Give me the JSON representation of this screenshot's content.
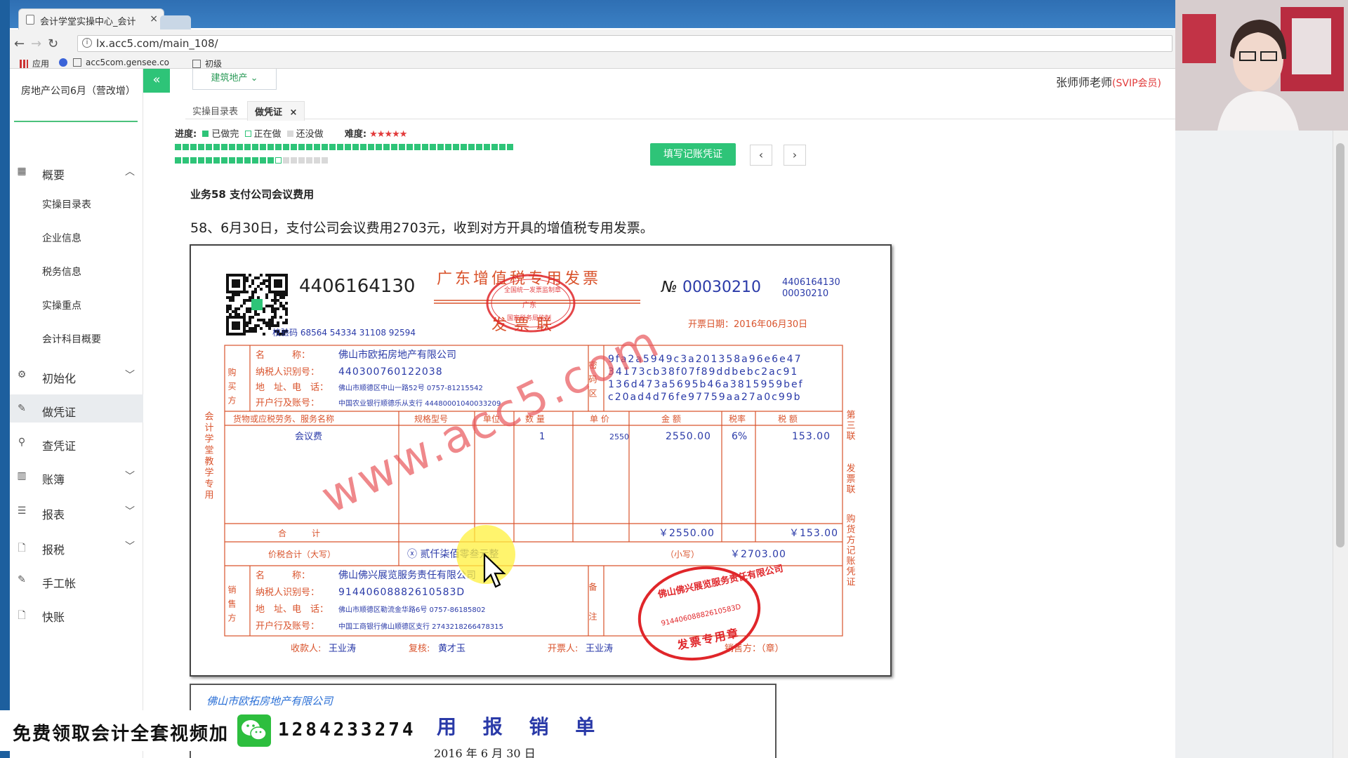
{
  "browser": {
    "tab_title": "会计学堂实操中心_会计",
    "tab_close": "×",
    "url": "lx.acc5.com/main_108/",
    "bookmarks": [
      "应用",
      "acc5com.gensee.co",
      "初级"
    ]
  },
  "header": {
    "collapse_icon": "«",
    "industry_select": "建筑地产",
    "teacher_name": "张师师老师",
    "teacher_badge": "(SVIP会员)"
  },
  "sidebar": {
    "company": "房地产公司6月（营改增）",
    "items": [
      {
        "label": "概要",
        "icon": "grid-icon",
        "expanded": true
      },
      {
        "label": "实操目录表"
      },
      {
        "label": "企业信息"
      },
      {
        "label": "税务信息"
      },
      {
        "label": "实操重点"
      },
      {
        "label": "会计科目概要"
      },
      {
        "label": "初始化",
        "icon": "gear-icon"
      },
      {
        "label": "做凭证",
        "icon": "pen-icon",
        "active": true
      },
      {
        "label": "查凭证",
        "icon": "search-icon"
      },
      {
        "label": "账簿",
        "icon": "book-icon"
      },
      {
        "label": "报表",
        "icon": "list-icon"
      },
      {
        "label": "报税",
        "icon": "file-icon"
      },
      {
        "label": "手工帐",
        "icon": "pen-icon"
      },
      {
        "label": "快账",
        "icon": "file-icon"
      }
    ]
  },
  "tabs": [
    {
      "label": "实操目录表",
      "active": false
    },
    {
      "label": "做凭证",
      "active": true,
      "close": "×"
    }
  ],
  "progress": {
    "label": "进度:",
    "legend_done": "已做完",
    "legend_doing": "正在做",
    "legend_todo": "还没做",
    "difficulty_label": "难度:",
    "difficulty_stars": "★★★★★",
    "done_count": 57,
    "doing_index": 58,
    "total": 64,
    "colors": {
      "done": "#2ec478",
      "todo": "#d9d9d9",
      "doing_border": "#2ec478"
    }
  },
  "actions": {
    "fill_voucher": "填写记账凭证",
    "prev": "‹",
    "next": "›"
  },
  "task": {
    "title": "业务58 支付公司会议费用",
    "description": "58、6月30日，支付公司会议费用2703元，收到对方开具的增值税专用发票。"
  },
  "invoice": {
    "code": "4406164130",
    "title": "广东增值税专用发票",
    "subtitle": "发票联",
    "no_label": "№",
    "number": "00030210",
    "code_small": "4406164130",
    "number_small": "00030210",
    "check_code": "校验码 68564 54334 31108 92594",
    "issue_date": "开票日期：2016年06月30日",
    "left_vertical": "会计学堂教学专用",
    "right_vertical_1": "第三联",
    "right_vertical_2": "发票联",
    "right_vertical_3": "购货方记账凭证",
    "buyer_label": "购买方",
    "buyer": {
      "name_label": "名　　　称：",
      "name": "佛山市欧拓房地产有限公司",
      "tax_label": "纳税人识别号：",
      "tax_id": "440300760122038",
      "addr_label": "地　址、电　话：",
      "addr": "佛山市顺德区中山一路52号 0757-81215542",
      "bank_label": "开户行及账号：",
      "bank": "中国农业银行顺德乐从支行 44480001040033209"
    },
    "cipher_label": "密码区",
    "cipher": [
      "9fa2a5949c3a201358a96e6e47",
      "34173cb38f07f89ddbebc2ac91",
      "136d473a5695b46a3815959bef",
      "c20ad4d76fe97759aa27a0c99b"
    ],
    "columns": [
      "货物或应税劳务、服务名称",
      "规格型号",
      "单位",
      "数 量",
      "单 价",
      "金 额",
      "税率",
      "税 额"
    ],
    "row": {
      "name": "会议费",
      "qty": "1",
      "price": "2550",
      "amount": "2550.00",
      "rate": "6%",
      "tax": "153.00"
    },
    "total_label": "合　　　计",
    "total_amount": "￥2550.00",
    "total_tax": "￥153.00",
    "grand_label": "价税合计（大写）",
    "grand_words": "ⓧ 贰仟柒佰零叁元整",
    "grand_small_label": "（小写）",
    "grand_small": "￥2703.00",
    "seller_label": "销售方",
    "seller": {
      "name_label": "名　　　称：",
      "name": "佛山佛兴展览服务责任有限公司",
      "tax_label": "纳税人识别号：",
      "tax_id": "91440608882610583D",
      "addr_label": "地　址、电　话：",
      "addr": "佛山市顺德区勒流金华路6号 0757-86185802",
      "bank_label": "开户行及账号：",
      "bank": "中国工商银行佛山顺德区支行 2743218266478315"
    },
    "remark_label": "备注",
    "payee_label": "收款人:",
    "payee": "王业涛",
    "reviewer_label": "复核:",
    "reviewer": "黄才玉",
    "drawer_label": "开票人:",
    "drawer": "王业涛",
    "seller_stamp_label": "销售方：（章）",
    "watermark": "www.acc5.com",
    "stamp_text": "佛山佛兴展览服务责任有限公司",
    "stamp_id": "91440608882610583D",
    "stamp_bottom": "发票专用章",
    "stamp_tax_bureau": "全国统一发票监制章",
    "stamp_tax_bureau_mid": "广东",
    "stamp_tax_bureau_bottom": "国家税务局监制",
    "colors": {
      "frame": "#d9532c",
      "ink": "#2a3aa8",
      "stamp": "#e0262a",
      "watermark": "#e8555a"
    }
  },
  "reimbursement": {
    "company": "佛山市欧拓房地产有限公司",
    "title": "用 报 销 单",
    "date": "2016 年 6 月 30 日"
  },
  "banner": {
    "text": "免费领取会计全套视频加",
    "wechat_icon": "wechat-icon",
    "number": "1284233274"
  }
}
